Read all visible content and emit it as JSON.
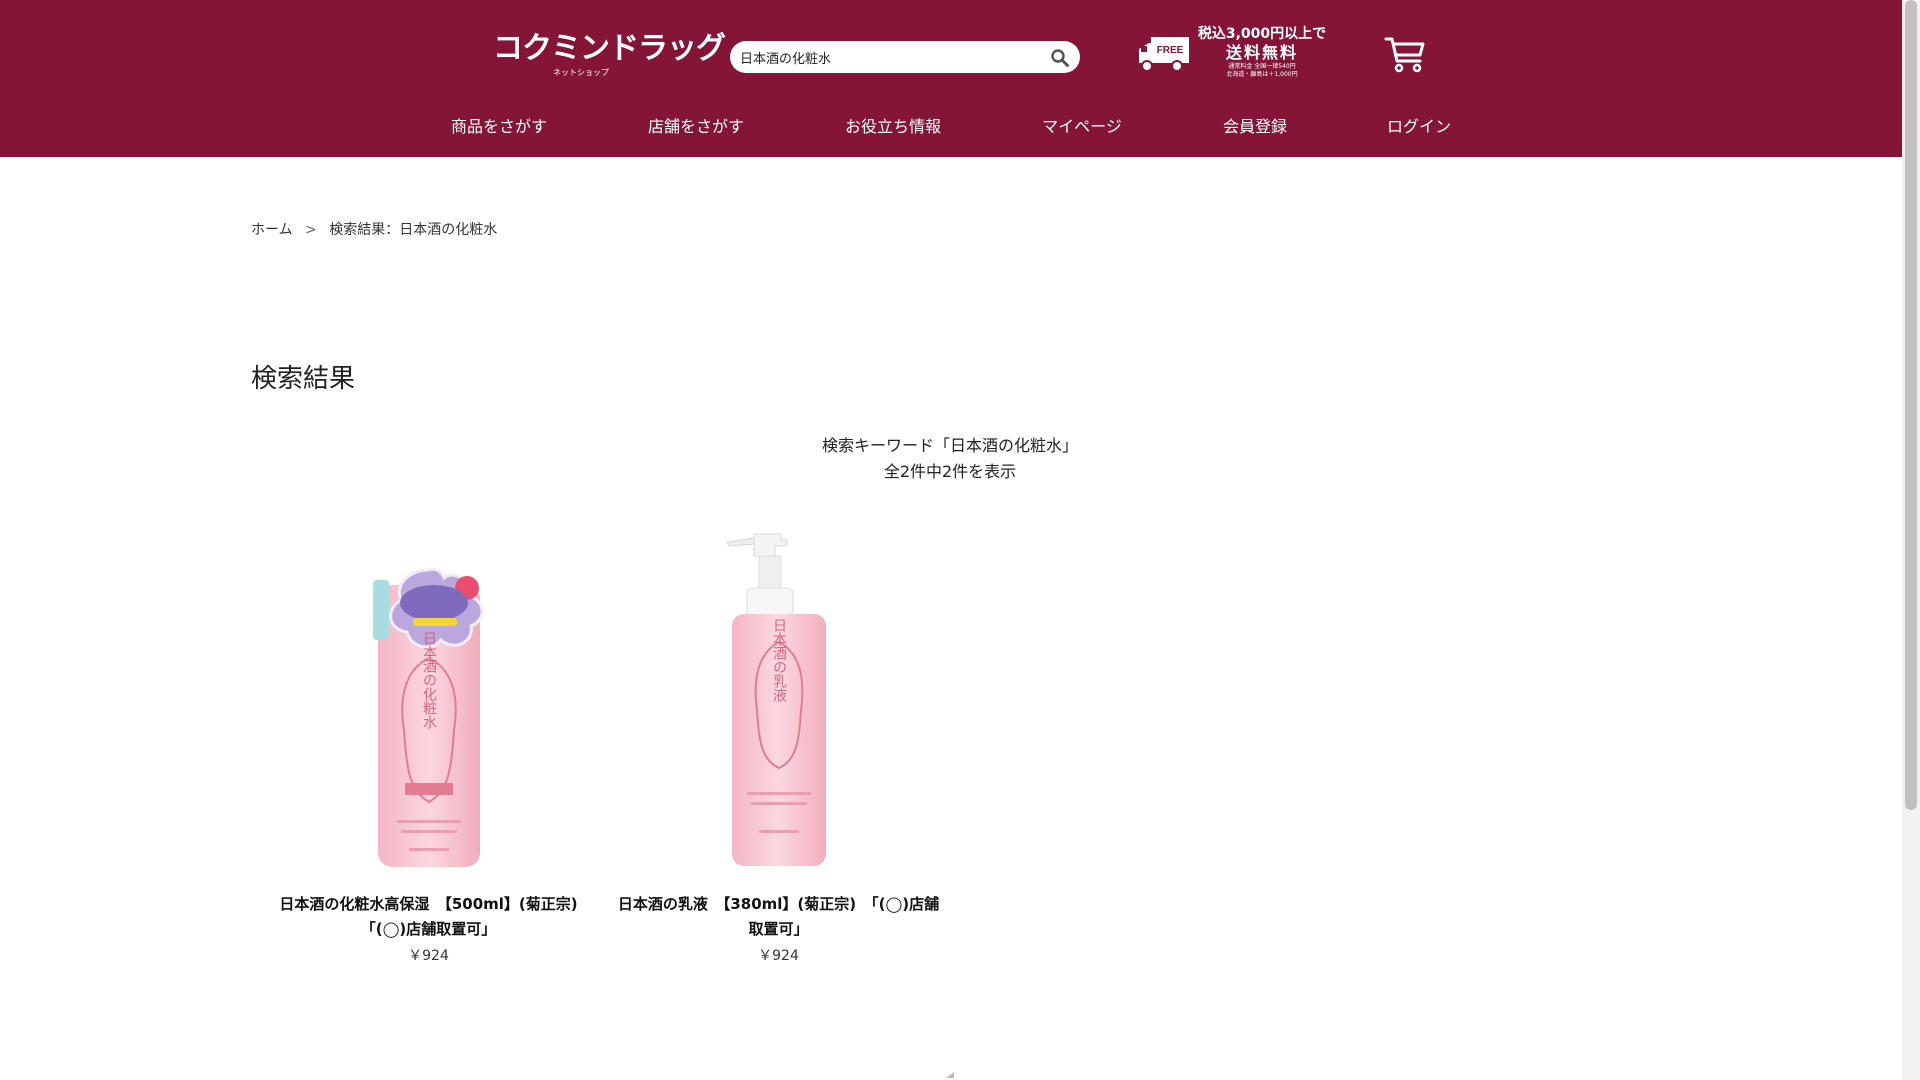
{
  "brand": {
    "logo_text": "コクミンドラッグ",
    "logo_sub": "ネットショップ",
    "color": "#841537"
  },
  "search": {
    "value": "日本酒の化粧水",
    "icon": "search-icon"
  },
  "shipping": {
    "line1": "税込3,000円以上で",
    "line2": "送料無料",
    "line3": "通常料金 全国一律540円",
    "line4": "北海道・離島は＋1,000円",
    "badge": "FREE"
  },
  "nav": {
    "items": [
      "商品をさがす",
      "店舗をさがす",
      "お役立ち情報",
      "マイページ",
      "会員登録",
      "ログイン"
    ]
  },
  "breadcrumb": {
    "home": "ホーム",
    "separator": ">",
    "current": "検索結果：日本酒の化粧水"
  },
  "page": {
    "title": "検索結果",
    "keyword_line": "検索キーワード「日本酒の化粧水」",
    "count_line": "全2件中2件を表示"
  },
  "products": [
    {
      "name": "日本酒の化粧水高保湿　【500ml】(菊正宗)　「(◯)店舗取置可」",
      "price": "￥924"
    },
    {
      "name": "日本酒の乳液　【380ml】(菊正宗)　「(◯)店舗取置可」",
      "price": "￥924"
    }
  ]
}
